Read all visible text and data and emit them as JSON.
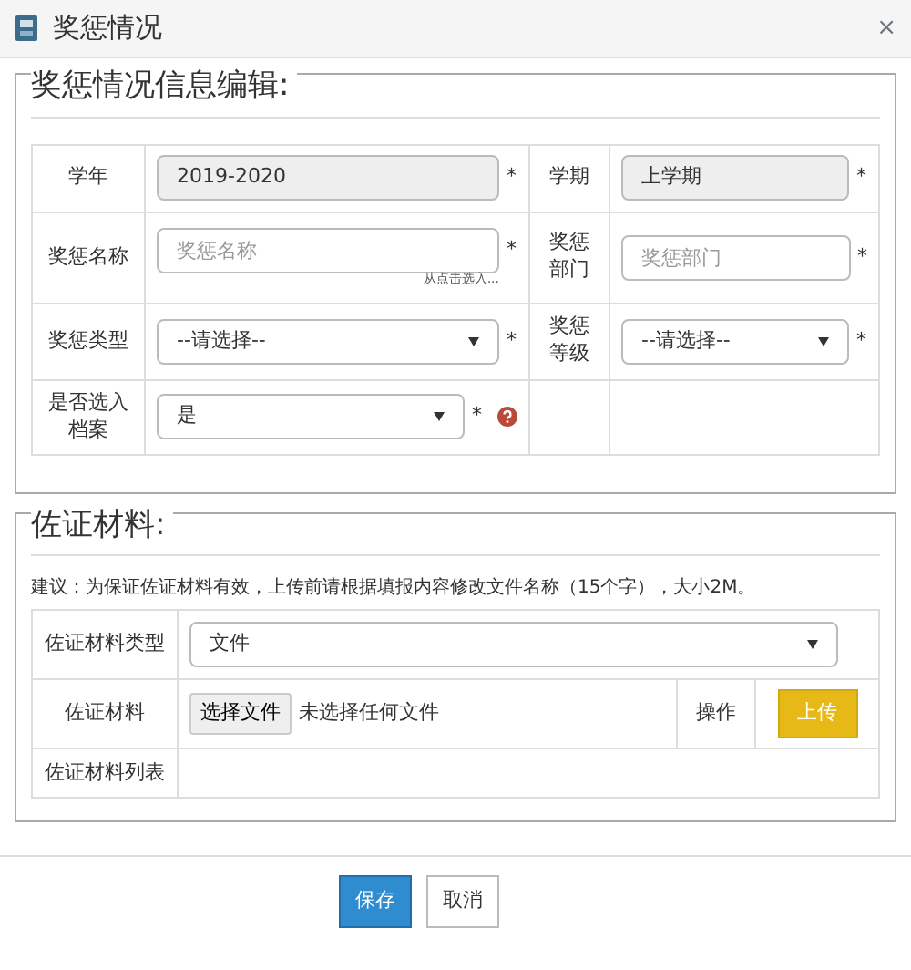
{
  "window": {
    "title": "奖惩情况",
    "close": "×"
  },
  "info_section": {
    "legend": "奖惩情况信息编辑:",
    "rows": [
      {
        "cells": [
          {
            "label": "学年",
            "kind": "readonly",
            "value": "2019-2020",
            "required": "*"
          },
          {
            "label": "学期",
            "kind": "readonly",
            "value": "上学期",
            "required": "*"
          }
        ]
      },
      {
        "cells": [
          {
            "label": "奖惩名称",
            "kind": "input",
            "placeholder": "奖惩名称",
            "required": "*",
            "note": "从点击选入..."
          },
          {
            "label": "奖惩部门",
            "kind": "input",
            "placeholder": "奖惩部门",
            "required": "*"
          }
        ]
      },
      {
        "cells": [
          {
            "label": "奖惩类型",
            "kind": "select",
            "value": "--请选择--",
            "required": "*"
          },
          {
            "label": "奖惩等级",
            "kind": "select",
            "value": "--请选择--",
            "required": "*"
          }
        ]
      },
      {
        "cells": [
          {
            "label": "是否选入档案",
            "kind": "select",
            "value": "是",
            "required": "*",
            "help": true
          },
          {
            "kind": "empty"
          }
        ]
      }
    ]
  },
  "evidence_section": {
    "legend": "佐证材料:",
    "advice": "建议：为保证佐证材料有效，上传前请根据填报内容修改文件名称（15个字），大小2M。",
    "type_row": {
      "label": "佐证材料类型",
      "value": "文件"
    },
    "file_row": {
      "label": "佐证材料",
      "choose_button": "选择文件",
      "file_status": "未选择任何文件",
      "action_label": "操作",
      "upload_button": "上传"
    },
    "list_row": {
      "label": "佐证材料列表"
    }
  },
  "footer": {
    "buttons": [
      {
        "label": "保存",
        "kind": "primary"
      },
      {
        "label": "取消",
        "kind": "default"
      }
    ]
  }
}
